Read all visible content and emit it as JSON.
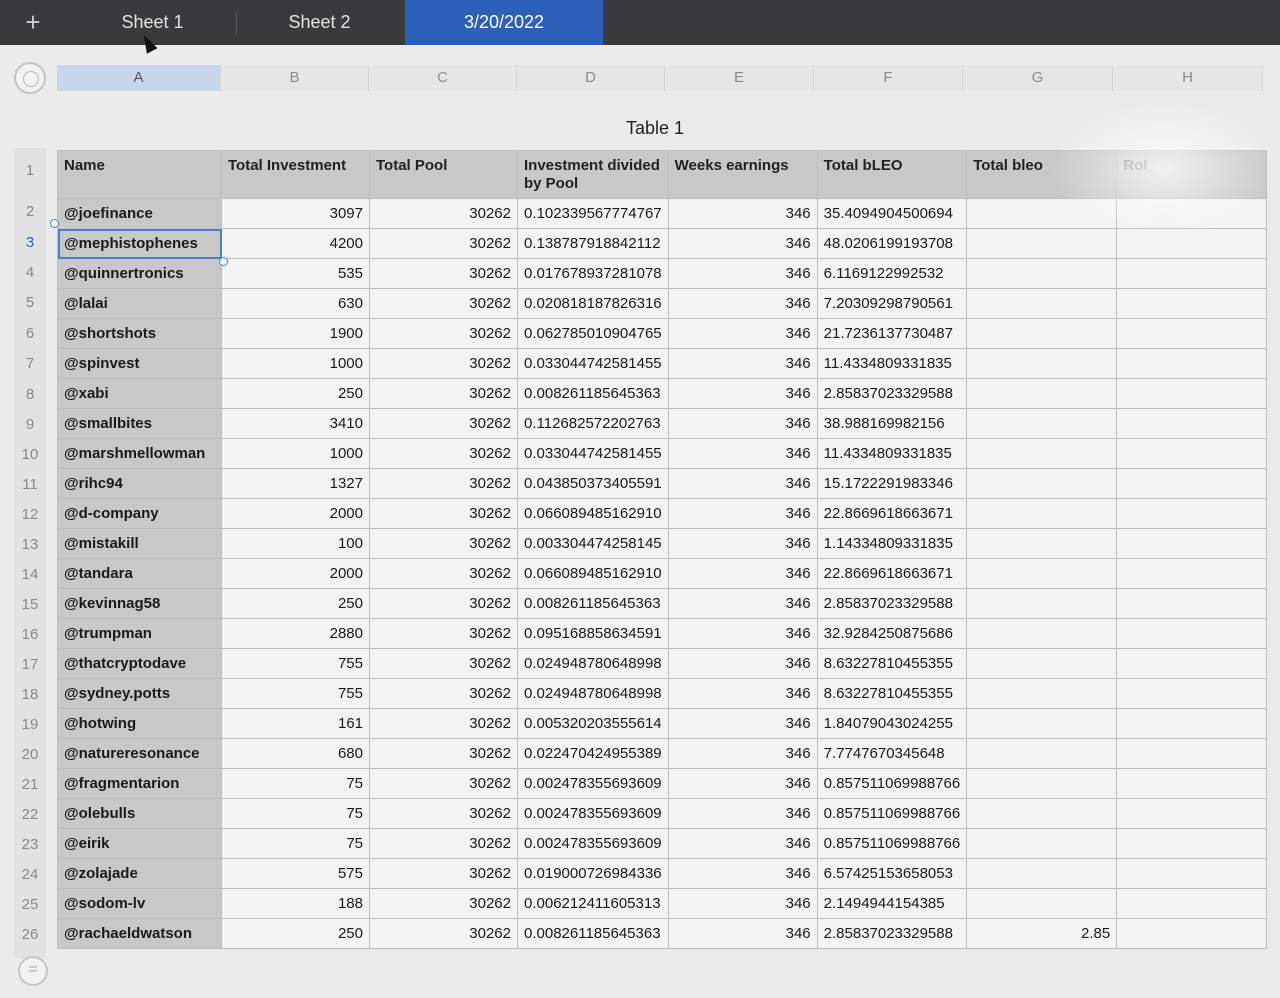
{
  "tabs": {
    "add_label": "+",
    "items": [
      {
        "label": "Sheet 1"
      },
      {
        "label": "Sheet 2"
      },
      {
        "label": "3/20/2022"
      }
    ]
  },
  "columns": [
    "A",
    "B",
    "C",
    "D",
    "E",
    "F",
    "G",
    "H"
  ],
  "table_title": "Table 1",
  "headers": [
    "Name",
    "Total Investment",
    "Total Pool",
    "Investment divided by Pool",
    "Weeks earnings",
    "Total bLEO",
    "Total bleo",
    "RoI"
  ],
  "row_numbers": [
    "1",
    "2",
    "3",
    "4",
    "5",
    "6",
    "7",
    "8",
    "9",
    "10",
    "11",
    "12",
    "13",
    "14",
    "15",
    "16",
    "17",
    "18",
    "19",
    "20",
    "21",
    "22",
    "23",
    "24",
    "25",
    "26"
  ],
  "rows": [
    [
      "@joefinance",
      "3097",
      "30262",
      "0.102339567774767",
      "346",
      "35.4094904500694",
      "",
      ""
    ],
    [
      "@mephistophenes",
      "4200",
      "30262",
      "0.138787918842112",
      "346",
      "48.0206199193708",
      "",
      ""
    ],
    [
      "@quinnertronics",
      "535",
      "30262",
      "0.017678937281078",
      "346",
      "6.1169122992532",
      "",
      ""
    ],
    [
      "@lalai",
      "630",
      "30262",
      "0.020818187826316",
      "346",
      "7.20309298790561",
      "",
      ""
    ],
    [
      "@shortshots",
      "1900",
      "30262",
      "0.062785010904765",
      "346",
      "21.7236137730487",
      "",
      ""
    ],
    [
      "@spinvest",
      "1000",
      "30262",
      "0.033044742581455",
      "346",
      "11.4334809331835",
      "",
      ""
    ],
    [
      "@xabi",
      "250",
      "30262",
      "0.008261185645363",
      "346",
      "2.85837023329588",
      "",
      ""
    ],
    [
      "@smallbites",
      "3410",
      "30262",
      "0.112682572202763",
      "346",
      "38.988169982156",
      "",
      ""
    ],
    [
      "@marshmellowman",
      "1000",
      "30262",
      "0.033044742581455",
      "346",
      "11.4334809331835",
      "",
      ""
    ],
    [
      "@rihc94",
      "1327",
      "30262",
      "0.043850373405591",
      "346",
      "15.1722291983346",
      "",
      ""
    ],
    [
      "@d-company",
      "2000",
      "30262",
      "0.066089485162910",
      "346",
      "22.8669618663671",
      "",
      ""
    ],
    [
      "@mistakill",
      "100",
      "30262",
      "0.003304474258145",
      "346",
      "1.14334809331835",
      "",
      ""
    ],
    [
      "@tandara",
      "2000",
      "30262",
      "0.066089485162910",
      "346",
      "22.8669618663671",
      "",
      ""
    ],
    [
      "@kevinnag58",
      "250",
      "30262",
      "0.008261185645363",
      "346",
      "2.85837023329588",
      "",
      ""
    ],
    [
      "@trumpman",
      "2880",
      "30262",
      "0.095168858634591",
      "346",
      "32.9284250875686",
      "",
      ""
    ],
    [
      "@thatcryptodave",
      "755",
      "30262",
      "0.024948780648998",
      "346",
      "8.63227810455355",
      "",
      ""
    ],
    [
      "@sydney.potts",
      "755",
      "30262",
      "0.024948780648998",
      "346",
      "8.63227810455355",
      "",
      ""
    ],
    [
      "@hotwing",
      "161",
      "30262",
      "0.005320203555614",
      "346",
      "1.84079043024255",
      "",
      ""
    ],
    [
      "@natureresonance",
      "680",
      "30262",
      "0.022470424955389",
      "346",
      "7.7747670345648",
      "",
      ""
    ],
    [
      "@fragmentarion",
      "75",
      "30262",
      "0.002478355693609",
      "346",
      "0.857511069988766",
      "",
      ""
    ],
    [
      "@olebulls",
      "75",
      "30262",
      "0.002478355693609",
      "346",
      "0.857511069988766",
      "",
      ""
    ],
    [
      "@eirik",
      "75",
      "30262",
      "0.002478355693609",
      "346",
      "0.857511069988766",
      "",
      ""
    ],
    [
      "@zolajade",
      "575",
      "30262",
      "0.019000726984336",
      "346",
      "6.57425153658053",
      "",
      ""
    ],
    [
      "@sodom-lv",
      "188",
      "30262",
      "0.006212411605313",
      "346",
      "2.1494944154385",
      "",
      ""
    ],
    [
      "@rachaeldwatson",
      "250",
      "30262",
      "0.008261185645363",
      "346",
      "2.85837023329588",
      "2.85",
      ""
    ]
  ],
  "colors": {
    "tabbar": "#3a3a3c",
    "active_tab": "#2b5fb8",
    "header_fill": "#c8c8c8",
    "selection": "#4a7fd0"
  },
  "icons": {
    "add_sheet": "plus-icon",
    "corner": "select-all-circle-icon",
    "bottom": "menu-circle-icon"
  }
}
